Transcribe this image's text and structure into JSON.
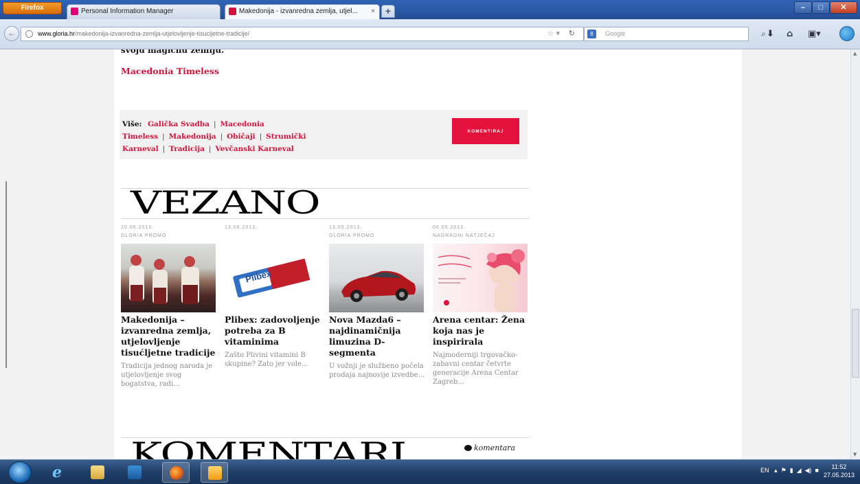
{
  "browser": {
    "firefox_button": "Firefox",
    "tabs": [
      {
        "label": "Personal Information Manager"
      },
      {
        "label": "Makedonija - izvanredna zemlja, utjel..."
      }
    ],
    "new_tab": "+",
    "url_domain": "www.gloria.hr",
    "url_path": "/makedonija-izvanredna-zemlja-utjelovljenje-tisucljetne-tradicije/",
    "search_placeholder": "Google"
  },
  "article": {
    "prev_text": "svoju magičnu zemlju.",
    "timeless_link": "Macedonia Timeless",
    "tags_label": "Više:",
    "tags": [
      "Galička Svadba",
      "Macedonia Timeless",
      "Makedonija",
      "Običaji",
      "Strumički Karneval",
      "Tradicija",
      "Vevčanski Karneval"
    ],
    "comment_button": "KOMENTIRAJ"
  },
  "related": {
    "heading": "VEZANO",
    "cards": [
      {
        "date": "20.05.2013.",
        "category": "GLORIA PROMO",
        "title": "Makedonija – izvanredna zemlja, utjelovljenje tisućljetne tradicije",
        "desc": "Tradicija jednog naroda je utjelovljenje svog bogatstva, radi..."
      },
      {
        "date": "13.05.2013.",
        "category": "",
        "title": "Plibex: zadovoljenje potreba za B vitaminima",
        "desc": "Zašto Plivini vitamini B skupine? Zato jer vole..."
      },
      {
        "date": "13.05.2013.",
        "category": "GLORIA PROMO",
        "title": "Nova Mazda6 – najdinamičnija limuzina D-segmenta",
        "desc": "U vožnji je službeno počela prodaja najnovije izvedbe..."
      },
      {
        "date": "06.05.2013.",
        "category": "NAGRADNI NATJEČAJ",
        "title": "Arena centar: Žena koja nas je inspirirala",
        "desc": "Najmoderniji trgovačko-zabavni centar četvrte generacije Arena Centar Zagreb..."
      }
    ],
    "plibex_label": "Plibex"
  },
  "comments": {
    "heading": "KOMENTARI",
    "count_label": "komentara"
  },
  "taskbar": {
    "lang": "EN",
    "time": "11:52",
    "date": "27.05.2013"
  },
  "colors": {
    "accent": "#e3123c",
    "link": "#d2153d"
  }
}
